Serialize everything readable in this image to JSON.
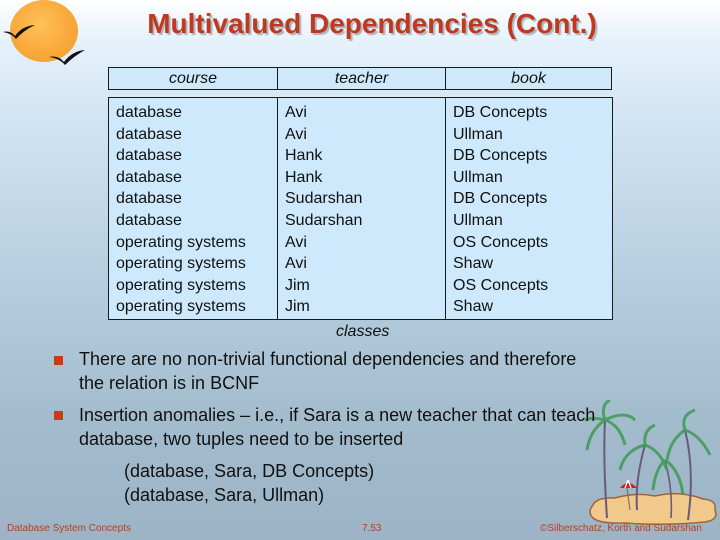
{
  "slide": {
    "title": "Multivalued Dependencies (Cont.)",
    "decor": {
      "top_left": "sun-with-birds",
      "bottom_right": "palm-tree-island"
    },
    "table": {
      "caption": "classes",
      "headers": [
        "course",
        "teacher",
        "book"
      ],
      "rows": [
        [
          "database",
          "Avi",
          "DB Concepts"
        ],
        [
          "database",
          "Avi",
          "Ullman"
        ],
        [
          "database",
          "Hank",
          "DB Concepts"
        ],
        [
          "database",
          "Hank",
          "Ullman"
        ],
        [
          "database",
          "Sudarshan",
          "DB Concepts"
        ],
        [
          "database",
          "Sudarshan",
          "Ullman"
        ],
        [
          "operating systems",
          "Avi",
          "OS Concepts"
        ],
        [
          "operating systems",
          "Avi",
          "Shaw"
        ],
        [
          "operating systems",
          "Jim",
          "OS Concepts"
        ],
        [
          "operating systems",
          "Jim",
          "Shaw"
        ]
      ]
    },
    "bullets": [
      {
        "line1": "There are no non-trivial functional dependencies and therefore",
        "line2": "the relation is in BCNF"
      },
      {
        "line1": "Insertion anomalies – i.e., if Sara is a new teacher that can teach",
        "line2": "database, two tuples need to be inserted"
      }
    ],
    "tuples": [
      "(database, Sara, DB Concepts)",
      "(database, Sara, Ullman)"
    ],
    "footer": {
      "left": "Database System Concepts",
      "center": "7.53",
      "right": "©Silberschatz, Korth and Sudarshan"
    },
    "colors": {
      "title": "#c0391e",
      "bullet": "#cc3a12",
      "table_fill": "#cde9fb",
      "footer_text": "#b4401f"
    }
  }
}
